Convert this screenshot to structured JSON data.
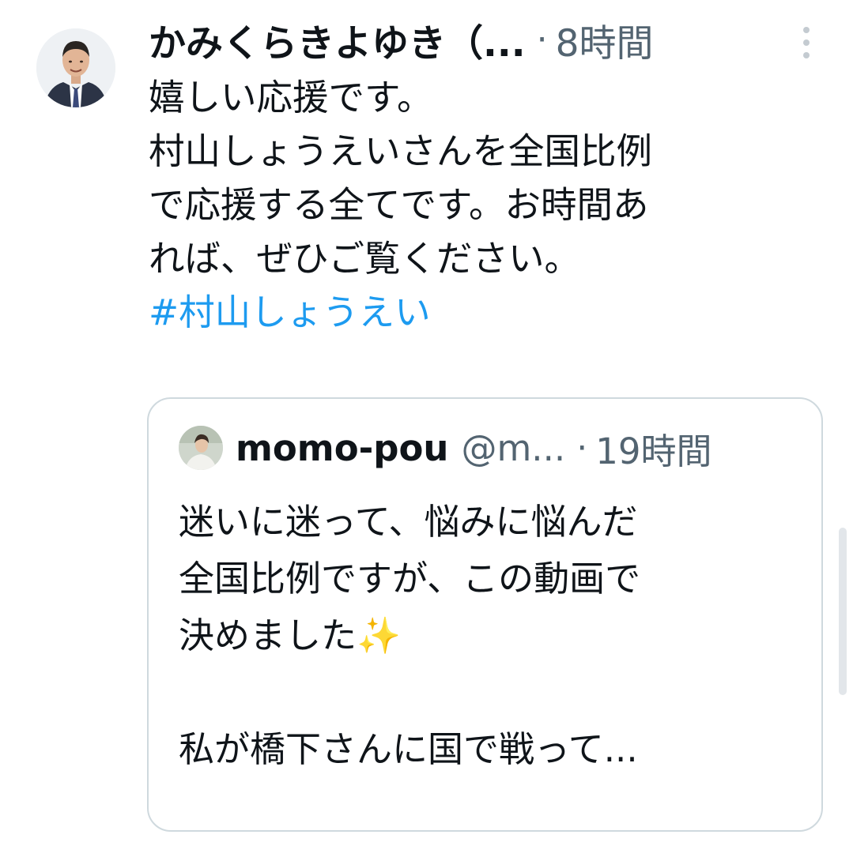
{
  "tweet": {
    "author_name": "かみくらきよゆき（...",
    "separator": "·",
    "time": "8時間",
    "more_icon": "more-vertical-icon",
    "lines": [
      "嬉しい応援です。",
      "村山しょうえいさんを全国比例",
      "で応援する全てです。お時間あ",
      "れば、ぜひご覧ください。"
    ],
    "hashtag": "#村山しょうえい"
  },
  "quote": {
    "author_name": "momo-pou",
    "handle": "@m...",
    "separator": "·",
    "time": "19時間",
    "lines": [
      "迷いに迷って、悩みに悩んだ",
      "全国比例ですが、この動画で",
      "決めました",
      "",
      "私が橋下さんに国で戦って..."
    ],
    "sparkle_emoji": "✨"
  },
  "colors": {
    "hashtag": "#1d9bf0",
    "secondary_text": "#536471",
    "border": "#cfd9de"
  }
}
